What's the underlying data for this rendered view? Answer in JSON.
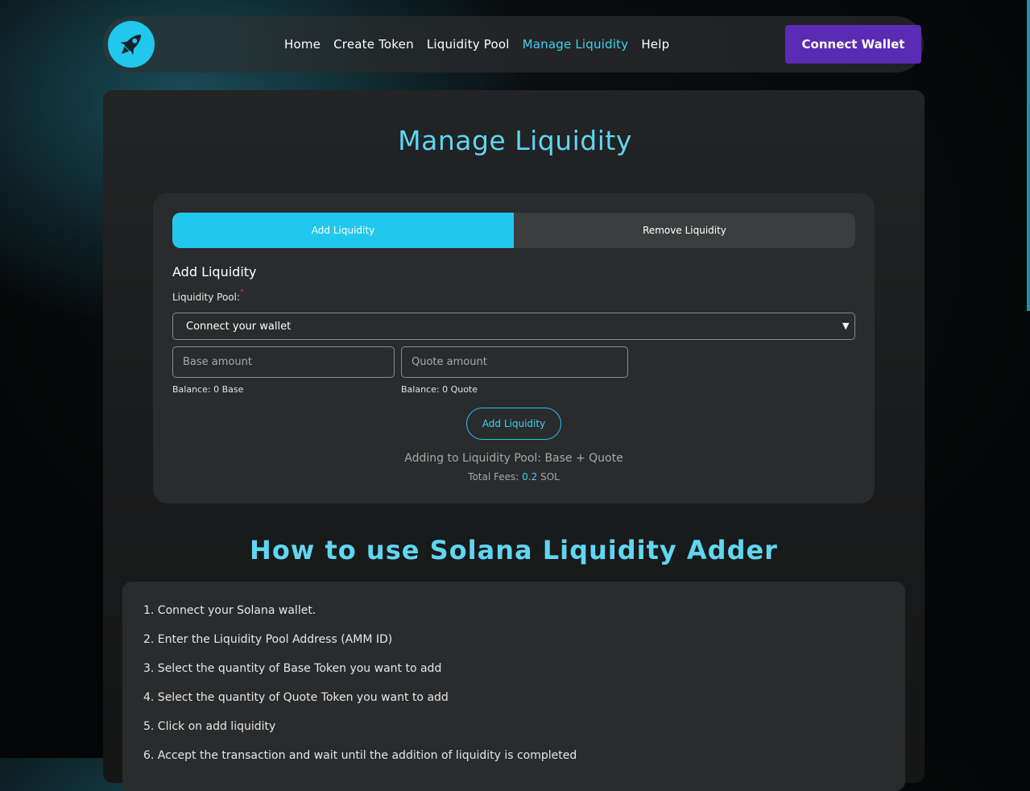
{
  "nav": {
    "links": [
      {
        "label": "Home"
      },
      {
        "label": "Create Token"
      },
      {
        "label": "Liquidity Pool"
      },
      {
        "label": "Manage Liquidity"
      },
      {
        "label": "Help"
      }
    ],
    "active_link": "Manage Liquidity",
    "connect_label": "Connect Wallet"
  },
  "page": {
    "title": "Manage Liquidity"
  },
  "tabs": [
    {
      "label": "Add Liquidity",
      "active": true
    },
    {
      "label": "Remove Liquidity",
      "active": false
    }
  ],
  "form": {
    "section_title": "Add Liquidity",
    "pool_label": "Liquidity Pool:",
    "required_mark": "*",
    "pool_selected": "Connect your wallet",
    "base_placeholder": "Base amount",
    "quote_placeholder": "Quote amount",
    "base_balance": "Balance: 0 Base",
    "quote_balance": "Balance: 0 Quote",
    "submit_label": "Add Liquidity",
    "pool_info": "Adding to Liquidity Pool: Base + Quote",
    "fees_label": "Total Fees:",
    "fees_value": "0.2",
    "fees_unit": "SOL"
  },
  "howto": {
    "title": "How to use Solana Liquidity Adder",
    "steps": [
      "1. Connect your Solana wallet.",
      "2. Enter the Liquidity Pool Address (AMM ID)",
      "3. Select the quantity of Base Token you want to add",
      "4. Select the quantity of Quote Token you want to add",
      "5. Click on add liquidity",
      "6. Accept the transaction and wait until the addition of liquidity is completed"
    ]
  },
  "colors": {
    "accent": "#22c7ee",
    "title": "#5fd6f2",
    "connect_button": "#5b2bb3",
    "panel": "#2a2b2c"
  },
  "icons": {
    "logo": "rocket-icon",
    "select_arrow": "chevron-down-icon"
  }
}
